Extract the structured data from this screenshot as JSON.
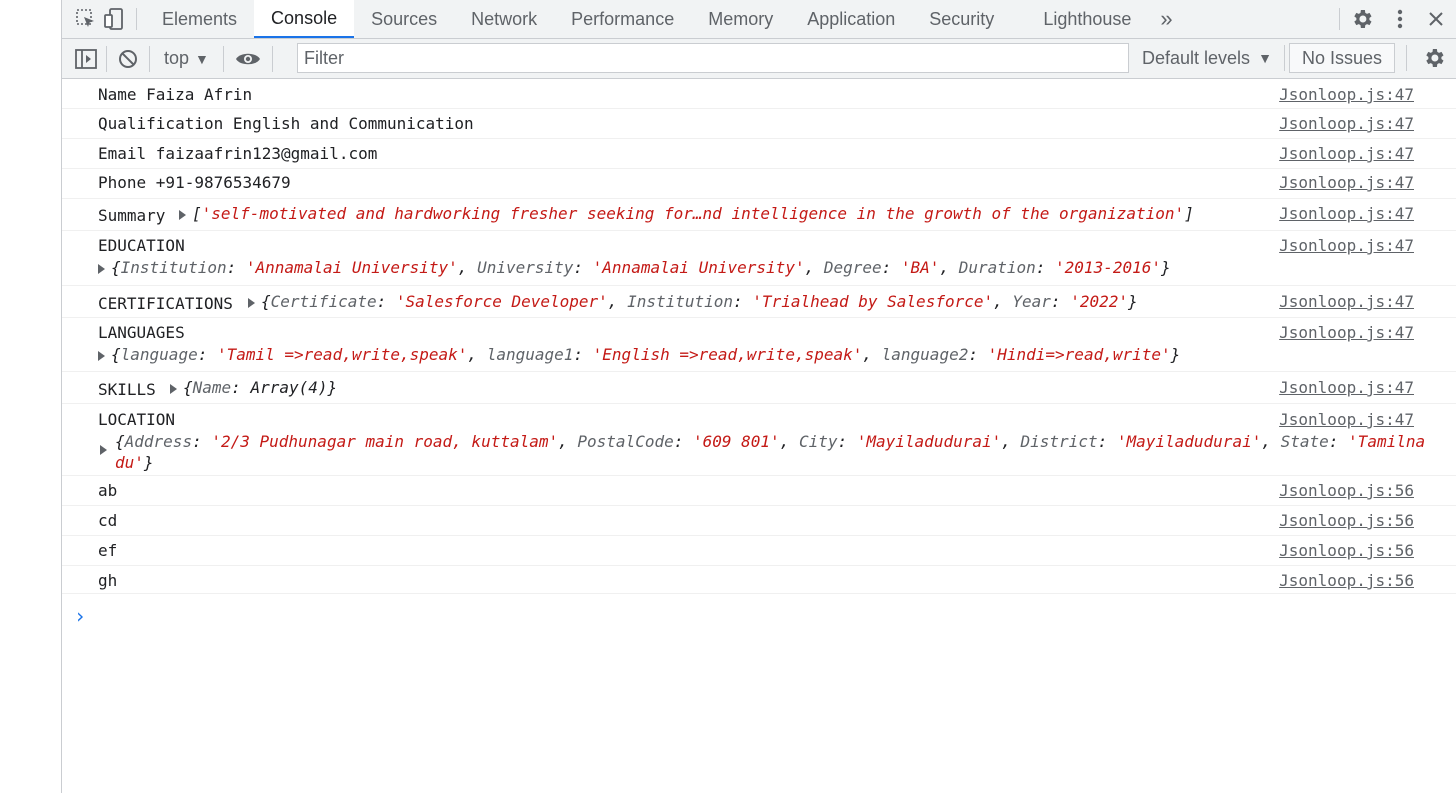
{
  "tabs": [
    "Elements",
    "Console",
    "Sources",
    "Network",
    "Performance",
    "Memory",
    "Application",
    "Security",
    "Lighthouse"
  ],
  "active_tab": "Console",
  "toolbar": {
    "context": "top",
    "filter_placeholder": "Filter",
    "levels": "Default levels",
    "issues": "No Issues"
  },
  "messages": [
    {
      "text": "Name Faiza Afrin",
      "source": "Jsonloop.js:47"
    },
    {
      "text": "Qualification English and Communication",
      "source": "Jsonloop.js:47"
    },
    {
      "text": "Email faizaafrin123@gmail.com",
      "source": "Jsonloop.js:47"
    },
    {
      "text": "Phone +91-9876534679",
      "source": "Jsonloop.js:47"
    },
    {
      "text": "Summary",
      "source": "Jsonloop.js:47",
      "array_preview": "'self-motivated and hardworking fresher seeking for…nd intelligence in the growth of the organization'"
    },
    {
      "text": "EDUCATION",
      "source": "Jsonloop.js:47",
      "object": [
        [
          "Institution",
          "'Annamalai University'"
        ],
        [
          "University",
          "'Annamalai University'"
        ],
        [
          "Degree",
          "'BA'"
        ],
        [
          "Duration",
          "'2013-2016'"
        ]
      ]
    },
    {
      "text": "CERTIFICATIONS",
      "source": "Jsonloop.js:47",
      "object": [
        [
          "Certificate",
          "'Salesforce Developer'"
        ],
        [
          "Institution",
          "'Trialhead by Salesforce'"
        ],
        [
          "Year",
          "'2022'"
        ]
      ]
    },
    {
      "text": "LANGUAGES",
      "source": "Jsonloop.js:47",
      "object": [
        [
          "language",
          "'Tamil =>read,write,speak'"
        ],
        [
          "language1",
          "'English =>read,write,speak'"
        ],
        [
          "language2",
          "'Hindi=>read,write'"
        ]
      ]
    },
    {
      "text": "SKILLS",
      "source": "Jsonloop.js:47",
      "object_plain": [
        [
          "Name",
          "Array(4)"
        ]
      ]
    },
    {
      "text": "LOCATION",
      "source": "Jsonloop.js:47",
      "object": [
        [
          "Address",
          "'2/3 Pudhunagar main road, kuttalam'"
        ],
        [
          "PostalCode",
          "'609 801'"
        ],
        [
          "City",
          "'Mayiladudurai'"
        ],
        [
          "District",
          "'Mayiladudurai'"
        ],
        [
          "State",
          "'Tamilnadu'"
        ]
      ]
    },
    {
      "text": "ab",
      "source": "Jsonloop.js:56"
    },
    {
      "text": "cd",
      "source": "Jsonloop.js:56"
    },
    {
      "text": "ef",
      "source": "Jsonloop.js:56"
    },
    {
      "text": "gh",
      "source": "Jsonloop.js:56"
    }
  ]
}
